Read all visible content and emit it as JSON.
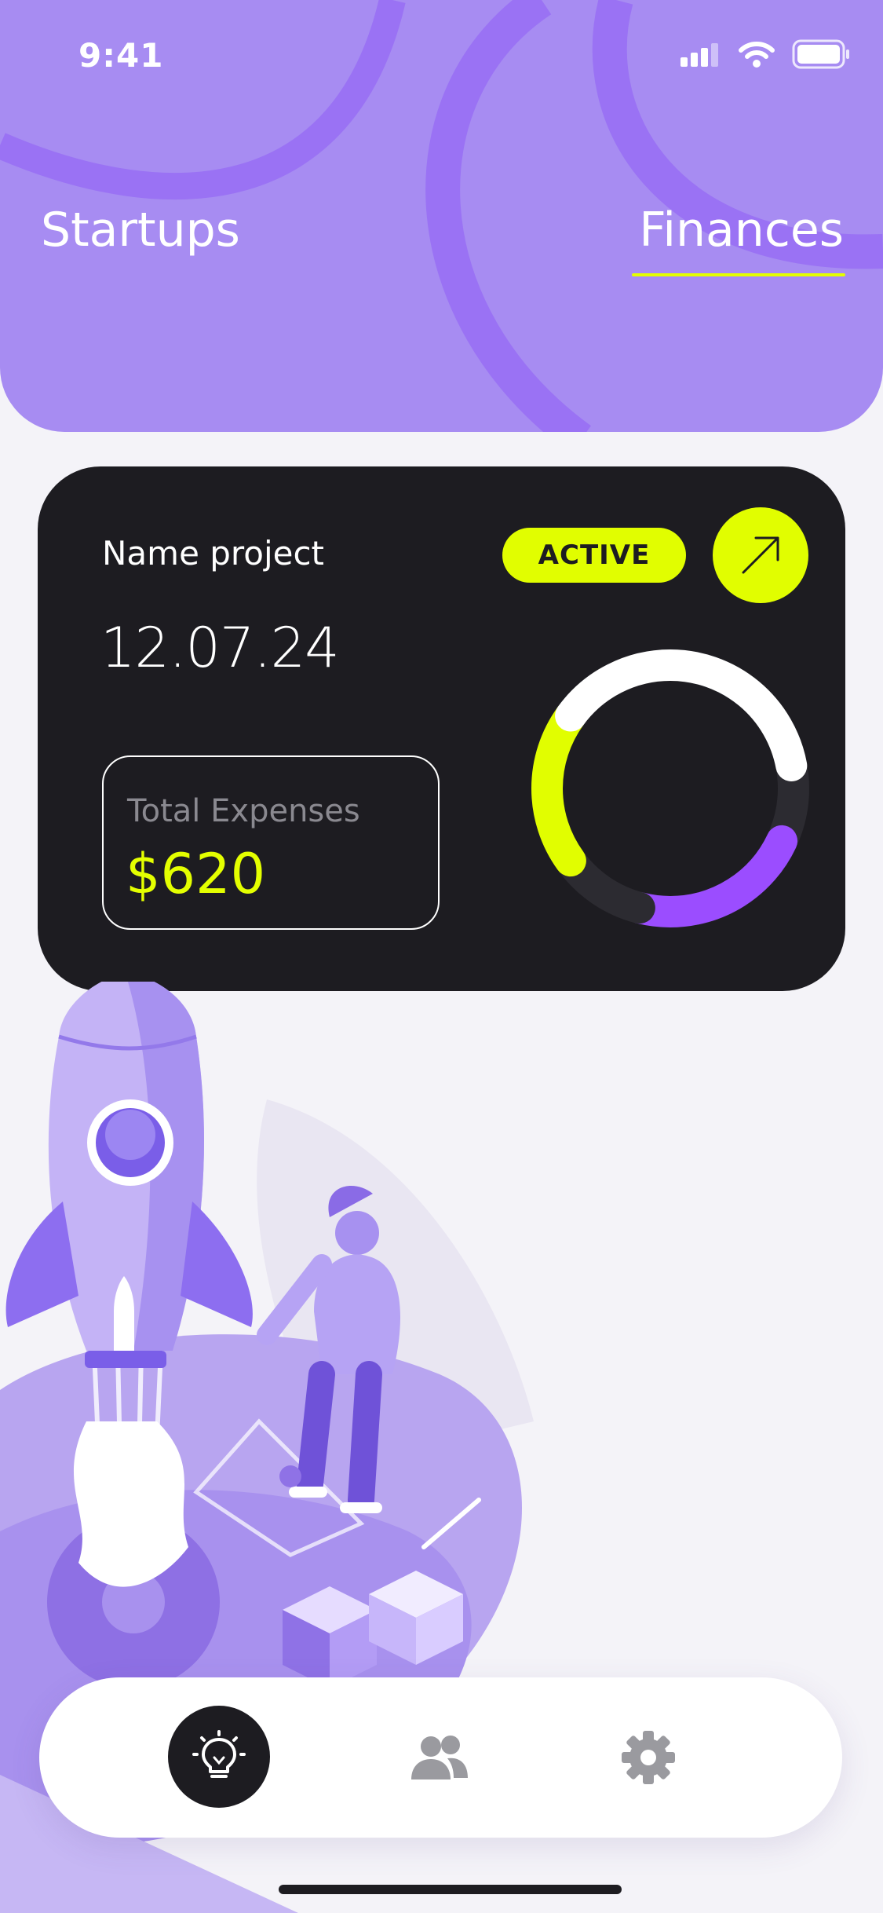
{
  "status_bar": {
    "time": "9:41",
    "icons": [
      "cellular-signal-icon",
      "wifi-icon",
      "battery-icon"
    ]
  },
  "header": {
    "tabs": [
      {
        "label": "Startups",
        "active": false
      },
      {
        "label": "Finances",
        "active": true
      }
    ]
  },
  "project_card": {
    "name": "Name project",
    "date": "12.07.24",
    "status": "ACTIVE",
    "open_icon": "arrow-up-right-icon",
    "expenses": {
      "label": "Total Expenses",
      "value": "$620"
    },
    "progress_ring": {
      "segments": [
        {
          "color": "#9b4dff",
          "fraction": 0.22
        },
        {
          "color": "#2c2b31",
          "fraction": 0.11
        },
        {
          "color": "#e1fe00",
          "fraction": 0.2
        },
        {
          "color": "#ffffff",
          "fraction": 0.37
        }
      ]
    }
  },
  "bottom_nav": {
    "items": [
      {
        "icon": "lightbulb-icon",
        "active": true
      },
      {
        "icon": "users-icon",
        "active": false
      },
      {
        "icon": "gear-icon",
        "active": false
      }
    ]
  },
  "colors": {
    "header_bg": "#a78cf2",
    "card_bg": "#1d1c21",
    "accent": "#e1fe00",
    "purple": "#9b4dff"
  }
}
